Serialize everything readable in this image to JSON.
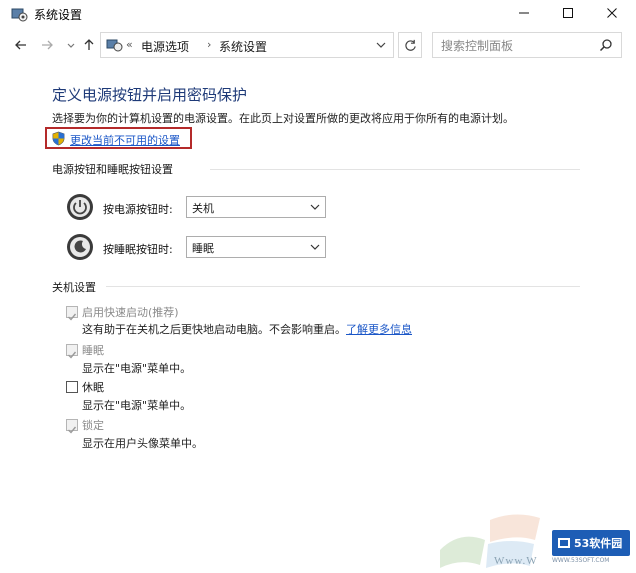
{
  "window": {
    "title": "系统设置"
  },
  "address_bar": {
    "overflow": "«",
    "crumbs": [
      "电源选项",
      "系统设置"
    ],
    "separator": "›"
  },
  "search": {
    "placeholder": "搜索控制面板"
  },
  "page": {
    "heading": "定义电源按钮并启用密码保护",
    "description": "选择要为你的计算机设置的电源设置。在此页上对设置所做的更改将应用于你所有的电源计划。",
    "change_link": "更改当前不可用的设置"
  },
  "power_buttons": {
    "section_title": "电源按钮和睡眠按钮设置",
    "power_label": "按电源按钮时:",
    "power_value": "关机",
    "sleep_label": "按睡眠按钮时:",
    "sleep_value": "睡眠"
  },
  "shutdown": {
    "section_title": "关机设置",
    "items": [
      {
        "label": "启用快速启动(推荐)",
        "desc": "这有助于在关机之后更快地启动电脑。不会影响重启。",
        "link": "了解更多信息",
        "checked": true,
        "enabled": false
      },
      {
        "label": "睡眠",
        "desc": "显示在\"电源\"菜单中。",
        "checked": true,
        "enabled": false
      },
      {
        "label": "休眠",
        "desc": "显示在\"电源\"菜单中。",
        "checked": false,
        "enabled": true
      },
      {
        "label": "锁定",
        "desc": "显示在用户头像菜单中。",
        "checked": true,
        "enabled": false
      }
    ]
  },
  "watermark": {
    "site_text": "Www.W",
    "logo_text": "53软件园",
    "logo_sub": "WWW.53SOFT.COM"
  },
  "colors": {
    "heading": "#1e3a78",
    "link": "#1a56c7",
    "highlight_box": "#b42a2a"
  }
}
